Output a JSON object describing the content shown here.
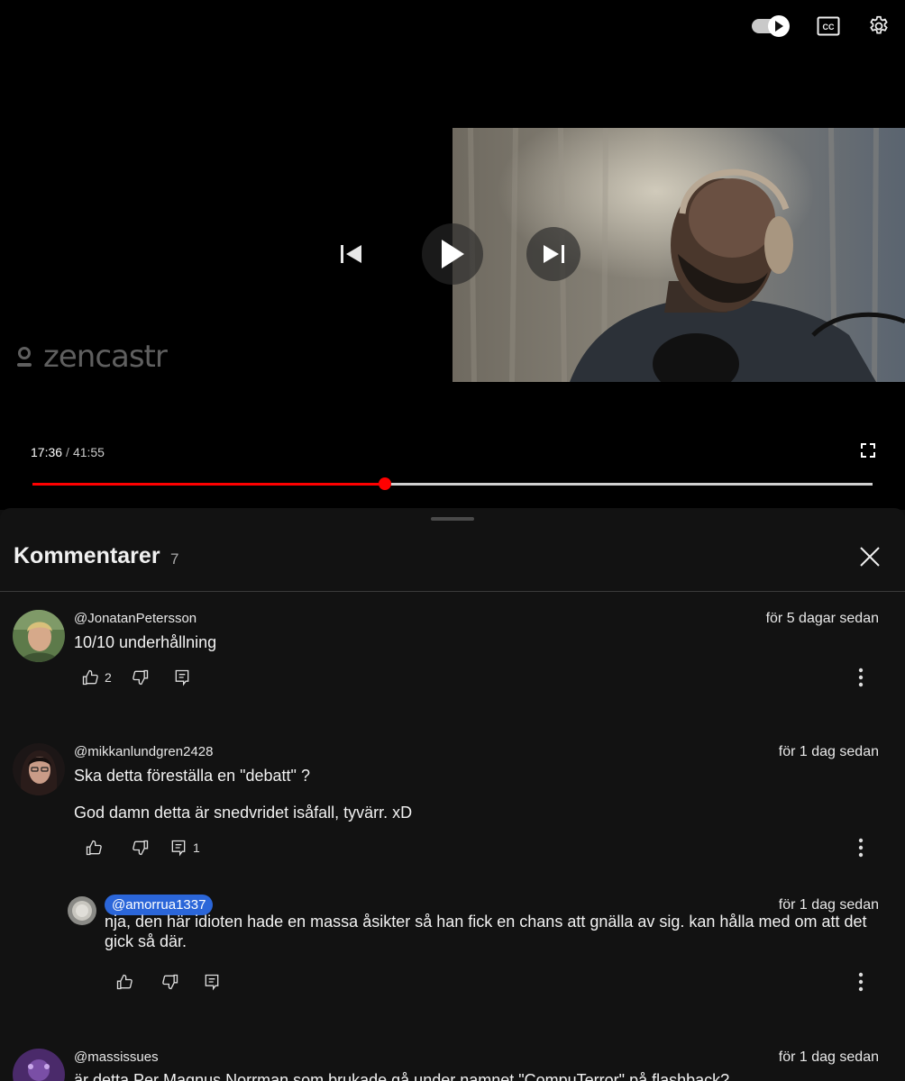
{
  "player": {
    "watermark": "zencastr",
    "time_current": "17:36",
    "time_separator": "/",
    "time_duration": "41:55",
    "progress_fraction": 0.42,
    "accent_color": "#ff0000",
    "top_icons": [
      "autoplay-toggle-icon",
      "closed-captions-icon",
      "settings-gear-icon"
    ],
    "closed_captions_label": "CC"
  },
  "comments_panel": {
    "title": "Kommentarer",
    "count": "7",
    "comments": [
      {
        "author": "@JonatanPetersson",
        "date": "för 5 dagar sedan",
        "text": "10/10 underhållning",
        "likes": "2",
        "replies": ""
      },
      {
        "author": "@mikkanlundgren2428",
        "date": "för 1 dag sedan",
        "text": "Ska detta föreställa en \"debatt\"  ?",
        "text2": "God damn detta är snedvridet isåfall, tyvärr. xD",
        "likes": "",
        "replies": "1"
      },
      {
        "author": "@massissues",
        "date": "för 1 dag sedan",
        "text": "är detta Per Magnus Norrman som brukade gå under namnet \"CompuTerror\" på flashback?"
      }
    ],
    "reply": {
      "mention": "@amorrua1337",
      "date": "för 1 dag sedan",
      "text": "nja, den här idioten hade en massa åsikter så han fick en chans att gnälla av sig. kan hålla med om att det gick så där."
    }
  }
}
